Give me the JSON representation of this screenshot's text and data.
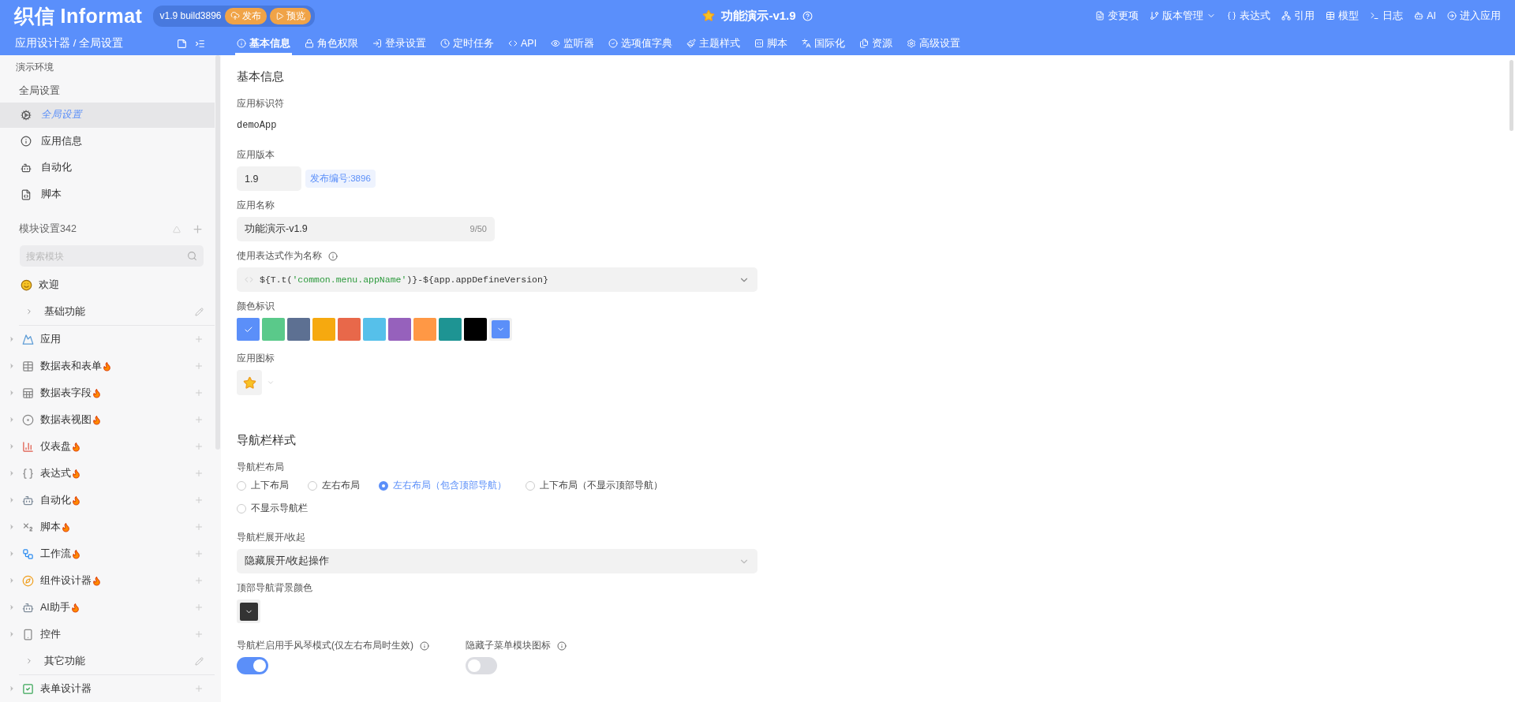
{
  "header": {
    "logo": "织信 Informat",
    "version": "v1.9 build3896",
    "buttons": [
      {
        "label": "发布",
        "kind": "publish"
      },
      {
        "label": "预览",
        "kind": "preview"
      }
    ],
    "title": "功能演示-v1.9",
    "actions": [
      {
        "label": "变更项",
        "has_menu": false
      },
      {
        "label": "版本管理",
        "has_menu": true
      },
      {
        "label": "表达式",
        "has_menu": false
      },
      {
        "label": "引用",
        "has_menu": false
      },
      {
        "label": "模型",
        "has_menu": false
      },
      {
        "label": "日志",
        "has_menu": false
      },
      {
        "label": "AI",
        "has_menu": false
      },
      {
        "label": "进入应用",
        "has_menu": false
      }
    ],
    "breadcrumb": "应用设计器 / 全局设置",
    "tabs": [
      {
        "label": "基本信息",
        "selected": true
      },
      {
        "label": "角色权限",
        "selected": false
      },
      {
        "label": "登录设置",
        "selected": false
      },
      {
        "label": "定时任务",
        "selected": false
      },
      {
        "label": "API",
        "selected": false
      },
      {
        "label": "监听器",
        "selected": false
      },
      {
        "label": "选项值字典",
        "selected": false
      },
      {
        "label": "主题样式",
        "selected": false
      },
      {
        "label": "脚本",
        "selected": false
      },
      {
        "label": "国际化",
        "selected": false
      },
      {
        "label": "资源",
        "selected": false
      },
      {
        "label": "高级设置",
        "selected": false
      }
    ]
  },
  "sidebar": {
    "environment": "演示环境",
    "section": "全局设置",
    "items": [
      {
        "label": "全局设置",
        "selected": true
      },
      {
        "label": "应用信息",
        "selected": false
      },
      {
        "label": "自动化",
        "selected": false
      },
      {
        "label": "脚本",
        "selected": false
      }
    ],
    "modules_title": "模块设置342",
    "search": {
      "placeholder": "搜索模块"
    },
    "modules": [
      {
        "kind": "page",
        "label": "欢迎"
      },
      {
        "kind": "group",
        "label": "基础功能",
        "children": [
          {
            "label": "应用",
            "hot": false,
            "expanded": false
          },
          {
            "label": "数据表和表单",
            "hot": true,
            "expanded": false
          },
          {
            "label": "数据表字段",
            "hot": true,
            "expanded": false
          },
          {
            "label": "数据表视图",
            "hot": true,
            "expanded": false
          },
          {
            "label": "仪表盘",
            "hot": true,
            "expanded": false
          },
          {
            "label": "表达式",
            "hot": true,
            "expanded": false
          },
          {
            "label": "自动化",
            "hot": true,
            "expanded": false
          },
          {
            "label": "脚本",
            "hot": true,
            "expanded": false
          },
          {
            "label": "工作流",
            "hot": true,
            "expanded": false
          },
          {
            "label": "组件设计器",
            "hot": true,
            "expanded": false
          },
          {
            "label": "AI助手",
            "hot": true,
            "expanded": false
          },
          {
            "label": "控件",
            "hot": false,
            "expanded": false
          }
        ]
      },
      {
        "kind": "group",
        "label": "其它功能",
        "children": [
          {
            "label": "表单设计器",
            "hot": false,
            "expanded": false
          }
        ]
      }
    ]
  },
  "basic": {
    "title": "基本信息",
    "identifier": {
      "label": "应用标识符",
      "value": "demoApp"
    },
    "version": {
      "label": "应用版本",
      "value": "1.9",
      "tag": "发布编号:3896"
    },
    "name": {
      "label": "应用名称",
      "value": "功能演示-v1.9",
      "count": "9/50"
    },
    "expression": {
      "label": "使用表达式作为名称",
      "tokens": [
        {
          "text": "${T.t(",
          "kind": "code"
        },
        {
          "text": "'common.menu.appName'",
          "kind": "string"
        },
        {
          "text": ")}-${app.appDefineVersion}",
          "kind": "code"
        }
      ]
    },
    "colors": {
      "label": "颜色标识",
      "swatches": [
        {
          "color": "#5b8ff9",
          "selected": true
        },
        {
          "color": "#5ac98a",
          "selected": false
        },
        {
          "color": "#5d7092",
          "selected": false
        },
        {
          "color": "#f6a90f",
          "selected": false
        },
        {
          "color": "#e8684a",
          "selected": false
        },
        {
          "color": "#56c0ea",
          "selected": false
        },
        {
          "color": "#9661bc",
          "selected": false
        },
        {
          "color": "#ff9845",
          "selected": false
        },
        {
          "color": "#1e9493",
          "selected": false
        },
        {
          "color": "#000000",
          "selected": false
        }
      ]
    },
    "icon": {
      "label": "应用图标"
    }
  },
  "nav": {
    "title": "导航栏样式",
    "layout": {
      "label": "导航栏布局",
      "options": [
        {
          "label": "上下布局",
          "selected": false
        },
        {
          "label": "左右布局",
          "selected": false
        },
        {
          "label": "左右布局（包含顶部导航）",
          "selected": true
        },
        {
          "label": "上下布局（不显示顶部导航）",
          "selected": false
        },
        {
          "label": "不显示导航栏",
          "selected": false
        }
      ]
    },
    "collapse": {
      "label": "导航栏展开/收起",
      "value": "隐藏展开/收起操作"
    },
    "top_bg": {
      "label": "顶部导航背景颜色",
      "color": "#333333"
    },
    "toggles": [
      {
        "label": "导航栏启用手风琴模式(仅左右布局时生效)",
        "on": true
      },
      {
        "label": "隐藏子菜单模块图标",
        "on": false
      }
    ]
  }
}
